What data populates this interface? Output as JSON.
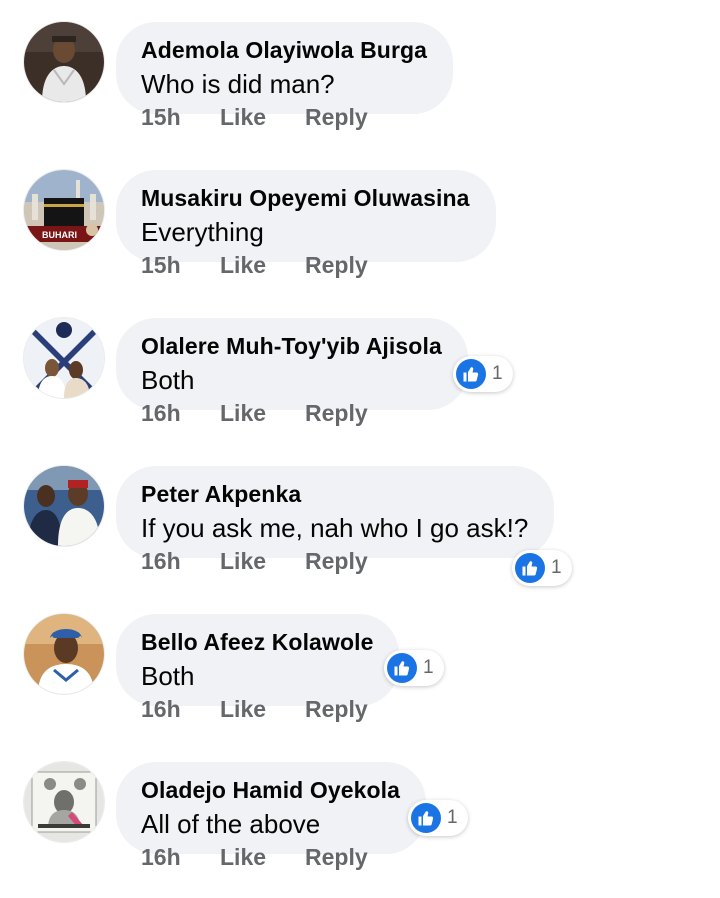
{
  "comments": [
    {
      "author": "Ademola Olayiwola Burga",
      "text": "Who is did man?",
      "time": "15h",
      "like_label": "Like",
      "reply_label": "Reply",
      "reactions": null
    },
    {
      "author": "Musakiru Opeyemi Oluwasina",
      "text": "Everything",
      "time": "15h",
      "like_label": "Like",
      "reply_label": "Reply",
      "reactions": null,
      "avatar_text": "BUHARI"
    },
    {
      "author": "Olalere Muh-Toy'yib Ajisola",
      "text": "Both",
      "time": "16h",
      "like_label": "Like",
      "reply_label": "Reply",
      "reactions": "1"
    },
    {
      "author": "Peter Akpenka",
      "text": "If you ask me, nah who I go ask!?",
      "time": "16h",
      "like_label": "Like",
      "reply_label": "Reply",
      "reactions": "1"
    },
    {
      "author": "Bello Afeez Kolawole",
      "text": "Both",
      "time": "16h",
      "like_label": "Like",
      "reply_label": "Reply",
      "reactions": "1"
    },
    {
      "author": "Oladejo Hamid Oyekola",
      "text": "All of the above",
      "time": "16h",
      "like_label": "Like",
      "reply_label": "Reply",
      "reactions": "1"
    }
  ],
  "colors": {
    "bubble": "#f0f2f5",
    "author": "#050505",
    "meta": "#65676b",
    "like_blue": "#1b74e4"
  },
  "icons": {
    "reaction": "thumbs-up-icon"
  }
}
